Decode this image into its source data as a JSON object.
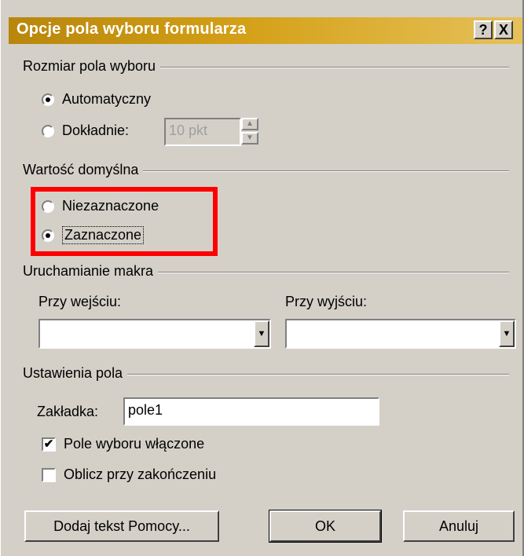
{
  "dialog": {
    "title": "Opcje pola wyboru formularza",
    "help_btn": "?",
    "close_btn": "X"
  },
  "size_group": {
    "label": "Rozmiar pola wyboru",
    "auto_label": "Automatyczny",
    "exact_label": "Dokładnie:",
    "exact_value": "10 pkt",
    "selected": "auto"
  },
  "default_group": {
    "label": "Wartość domyślna",
    "unchecked_label": "Niezaznaczone",
    "checked_label": "Zaznaczone",
    "selected": "checked",
    "highlight_color": "#ff0000"
  },
  "macro_group": {
    "label": "Uruchamianie makra",
    "entry_label": "Przy wejściu:",
    "exit_label": "Przy wyjściu:",
    "entry_value": "",
    "exit_value": ""
  },
  "field_group": {
    "label": "Ustawienia pola",
    "bookmark_label": "Zakładka:",
    "bookmark_value": "pole1",
    "enabled_label": "Pole wyboru włączone",
    "enabled_checked": true,
    "calc_label": "Oblicz przy zakończeniu",
    "calc_checked": false
  },
  "buttons": {
    "help_text": "Dodaj tekst Pomocy...",
    "ok": "OK",
    "cancel": "Anuluj"
  },
  "colors": {
    "title_bar": "#d4a017",
    "dialog_bg": "#d4d0c8"
  }
}
